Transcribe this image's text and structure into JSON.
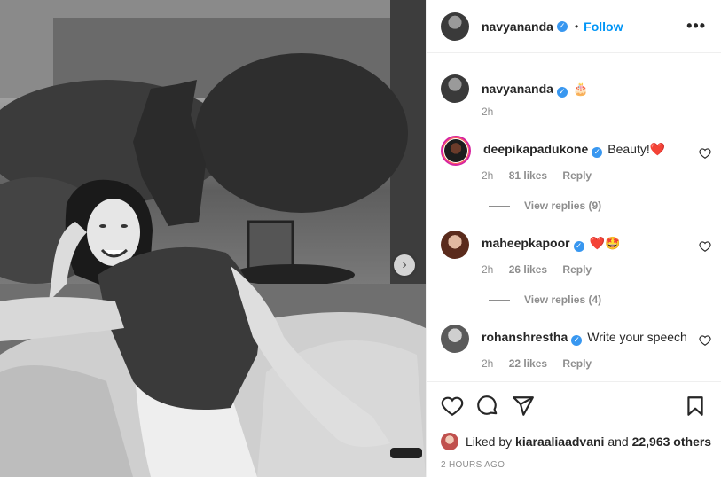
{
  "post": {
    "author": "navyananda",
    "follow_label": "Follow",
    "separator": "•",
    "more_label": "•••",
    "next_label": "›"
  },
  "caption": {
    "username": "navyananda",
    "text": "🎂",
    "time": "2h"
  },
  "comments": [
    {
      "username": "deepikapadukone",
      "text": "Beauty!❤️",
      "time": "2h",
      "likes": "81 likes",
      "reply_label": "Reply",
      "view_replies": "View replies (9)"
    },
    {
      "username": "maheepkapoor",
      "text": "❤️🤩",
      "time": "2h",
      "likes": "26 likes",
      "reply_label": "Reply",
      "view_replies": "View replies (4)"
    },
    {
      "username": "rohanshrestha",
      "text": "Write your speech",
      "time": "2h",
      "likes": "22 likes",
      "reply_label": "Reply"
    }
  ],
  "likes": {
    "prefix": "Liked by",
    "user": "kiaraaliaadvani",
    "joiner": "and",
    "others": "22,963 others"
  },
  "timestamp": "2 HOURS AGO",
  "icons": {
    "like": "heart-icon",
    "comment": "comment-icon",
    "share": "send-icon",
    "save": "bookmark-icon",
    "verified": "verified-badge-icon",
    "more": "more-options-icon"
  },
  "colors": {
    "follow": "#0095f6",
    "verified": "#3897f0",
    "muted": "#8e8e8e"
  }
}
